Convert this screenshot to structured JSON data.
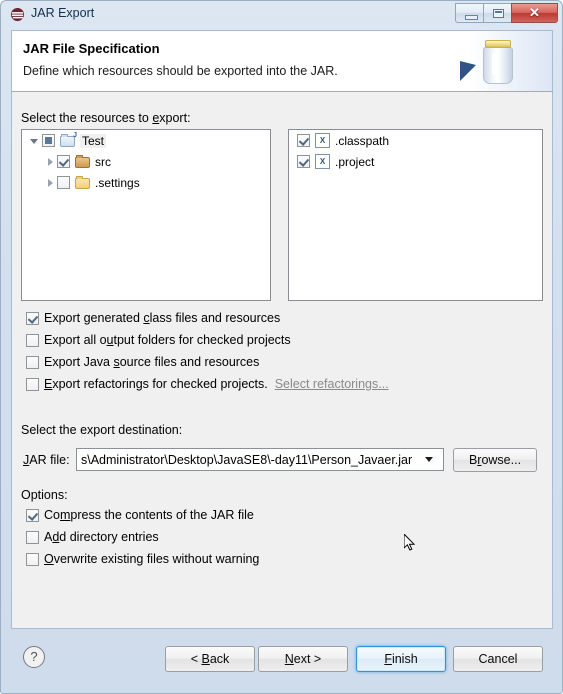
{
  "window": {
    "title": "JAR Export",
    "app_icon": "eclipse-icon",
    "controls": {
      "minimize": "minimize-icon",
      "maximize": "restore-icon",
      "close": "✕"
    }
  },
  "header": {
    "title": "JAR File Specification",
    "subtitle": "Define which resources should be exported into the JAR.",
    "artwork": "jar-jar-icon"
  },
  "resources": {
    "label_prefix": "Select the resources to ",
    "label_mnemonic": "e",
    "label_suffix": "xport:",
    "tree": [
      {
        "name": "Test",
        "checkbox": "partial",
        "icon": "java-project-folder-icon",
        "expanded": true,
        "selected": true,
        "indent": 0
      },
      {
        "name": "src",
        "checkbox": "checked",
        "icon": "source-folder-icon",
        "expanded": false,
        "selected": false,
        "indent": 1
      },
      {
        "name": ".settings",
        "checkbox": "unchecked",
        "icon": "folder-icon",
        "expanded": false,
        "selected": false,
        "indent": 1
      }
    ],
    "files": [
      {
        "name": ".classpath",
        "checkbox": "checked",
        "icon": "xml-file-icon",
        "badge": "X"
      },
      {
        "name": ".project",
        "checkbox": "checked",
        "icon": "xml-file-icon",
        "badge": "X"
      }
    ]
  },
  "export_options": [
    {
      "pre": "Export generated ",
      "mnemonic": "c",
      "post": "lass files and resources",
      "checked": true,
      "enabled": true,
      "link": null
    },
    {
      "pre": "Export all o",
      "mnemonic": "u",
      "post": "tput folders for checked projects",
      "checked": false,
      "enabled": true,
      "link": null
    },
    {
      "pre": "Export Java ",
      "mnemonic": "s",
      "post": "ource files and resources",
      "checked": false,
      "enabled": true,
      "link": null
    },
    {
      "pre": "",
      "mnemonic": "E",
      "post": "xport refactorings for checked projects.",
      "checked": false,
      "enabled": false,
      "link": "Select refactorings..."
    }
  ],
  "destination": {
    "section_label": "Select the export destination:",
    "field_label_pre": "",
    "field_label_mnemonic": "J",
    "field_label_post": "AR file:",
    "value": "s\\Administrator\\Desktop\\JavaSE8\\-day11\\Person_Javaer.jar",
    "dropdown_icon": "chevron-down-icon",
    "browse_pre": "B",
    "browse_mnemonic": "r",
    "browse_post": "owse..."
  },
  "options": {
    "section_label": "Options:",
    "items": [
      {
        "pre": "Co",
        "mnemonic": "m",
        "post": "press the contents of the JAR file",
        "checked": true
      },
      {
        "pre": "A",
        "mnemonic": "d",
        "post": "d directory entries",
        "checked": false
      },
      {
        "pre": "",
        "mnemonic": "O",
        "post": "verwrite existing files without warning",
        "checked": false
      }
    ]
  },
  "footer": {
    "help_icon": "?",
    "buttons": [
      {
        "pre": "< ",
        "mnemonic": "B",
        "post": "ack",
        "focused": false
      },
      {
        "pre": "",
        "mnemonic": "N",
        "post": "ext >",
        "focused": false
      },
      {
        "pre": "",
        "mnemonic": "F",
        "post": "inish",
        "focused": true
      },
      {
        "pre": "Cancel",
        "mnemonic": "",
        "post": "",
        "focused": false
      }
    ]
  },
  "colors": {
    "window_chrome": "#d2dfee",
    "panel_bg": "#f0f0f0",
    "focus_blue": "#2f93d8",
    "close_red": "#b93a31",
    "link_disabled": "#8a8a8a"
  }
}
